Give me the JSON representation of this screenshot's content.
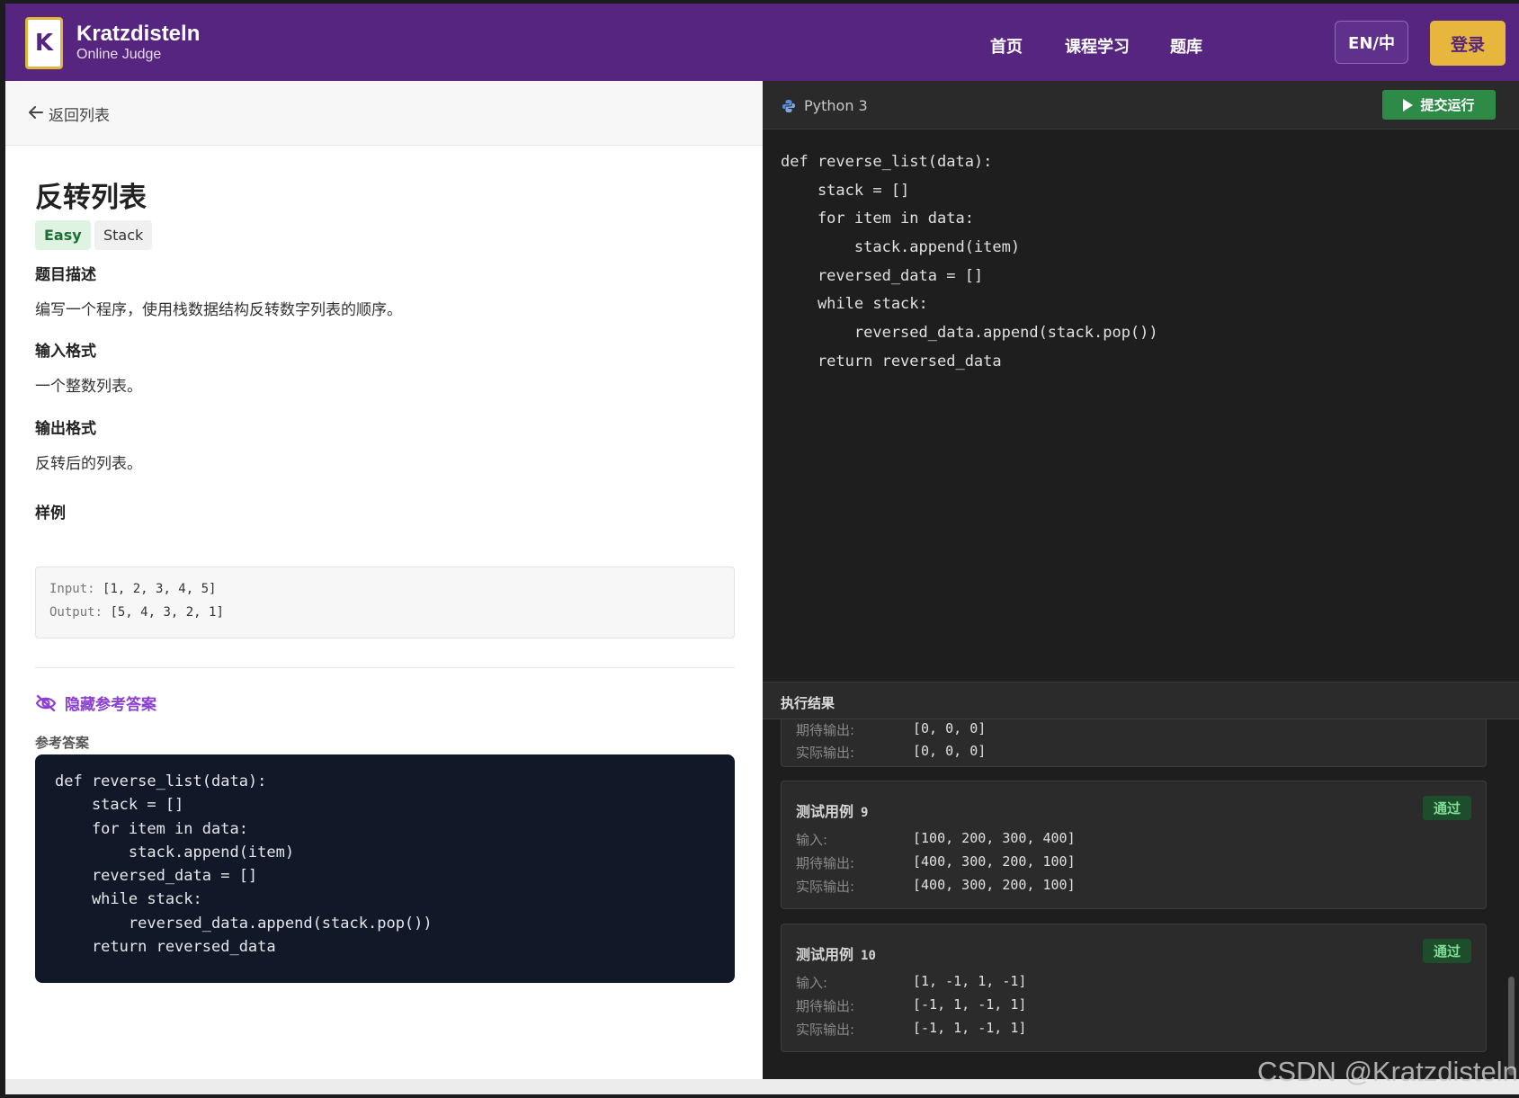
{
  "header": {
    "logo_letter": "K",
    "brand_name": "Kratzdisteln",
    "brand_sub": "Online Judge",
    "nav": [
      "首页",
      "课程学习",
      "题库"
    ],
    "lang": "EN/中",
    "login": "登录",
    "bg_color": "#56257f",
    "accent_color": "#e7b63c"
  },
  "left": {
    "back_label": "返回列表",
    "title": "反转列表",
    "tags": [
      "Easy",
      "Stack"
    ],
    "desc_heading": "题目描述",
    "desc_text": "编写一个程序，使用栈数据结构反转数字列表的顺序。",
    "input_heading": "输入格式",
    "input_text": "一个整数列表。",
    "output_heading": "输出格式",
    "output_text": "反转后的列表。",
    "sample_heading": "样例",
    "sample": {
      "input_key": "Input:",
      "input_val": "[1, 2, 3, 4, 5]",
      "output_key": "Output:",
      "output_val": "[5, 4, 3, 2, 1]"
    },
    "hide_label": "隐藏参考答案",
    "ref_label": "参考答案",
    "ref_code": [
      "def reverse_list(data):",
      "    stack = []",
      "    for item in data:",
      "        stack.append(item)",
      "    reversed_data = []",
      "    while stack:",
      "        reversed_data.append(stack.pop())",
      "    return reversed_data"
    ]
  },
  "right": {
    "language": "Python 3",
    "run_label": "提交运行",
    "editor_code": [
      "def reverse_list(data):",
      "    stack = []",
      "    for item in data:",
      "        stack.append(item)",
      "    reversed_data = []",
      "    while stack:",
      "        reversed_data.append(stack.pop())",
      "    return reversed_data"
    ],
    "results_title": "执行结果",
    "partial_case": {
      "expected_key": "期待输出:",
      "expected_val": "[0, 0, 0]",
      "actual_key": "实际输出:",
      "actual_val": "[0, 0, 0]"
    },
    "cases": [
      {
        "title": "测试用例",
        "num": "9",
        "status": "通过",
        "input_key": "输入:",
        "input_val": "[100, 200, 300, 400]",
        "expected_key": "期待输出:",
        "expected_val": "[400, 300, 200, 100]",
        "actual_key": "实际输出:",
        "actual_val": "[400, 300, 200, 100]"
      },
      {
        "title": "测试用例",
        "num": "10",
        "status": "通过",
        "input_key": "输入:",
        "input_val": "[1, -1, 1, -1]",
        "expected_key": "期待输出:",
        "expected_val": "[-1, 1, -1, 1]",
        "actual_key": "实际输出:",
        "actual_val": "[-1, 1, -1, 1]"
      }
    ]
  },
  "watermark": "CSDN @Kratzdisteln"
}
